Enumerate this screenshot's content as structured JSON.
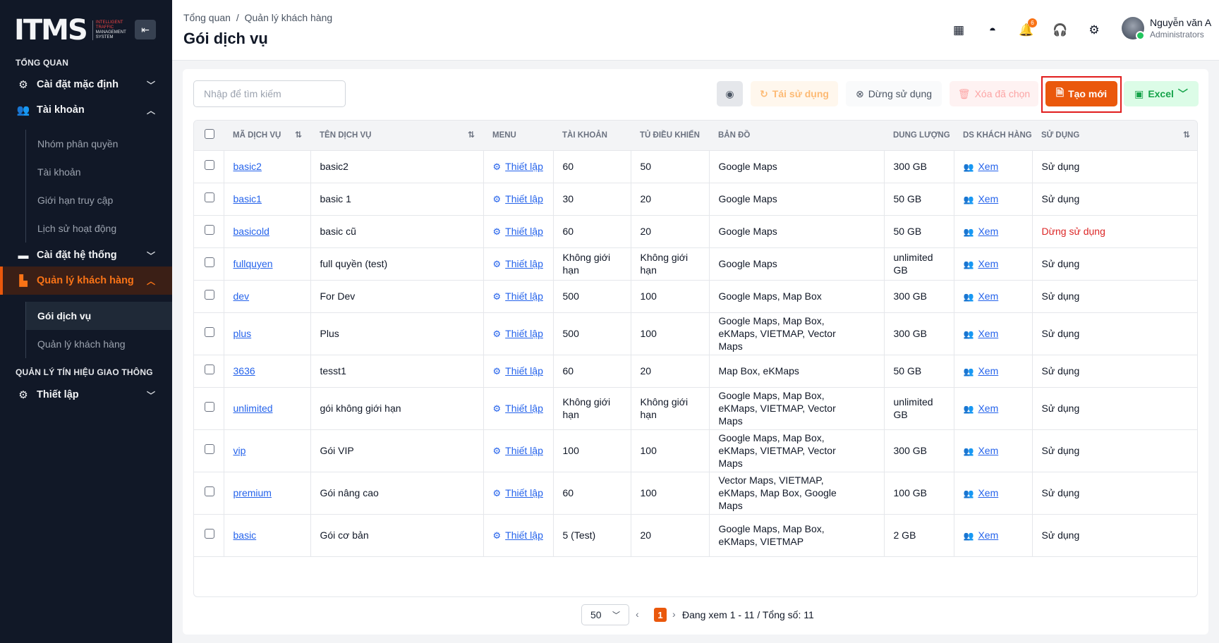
{
  "sidebar": {
    "logo": "ITMS",
    "logo_sub": [
      "INTELLIGENT",
      "TRAFFIC",
      "MANAGEMENT",
      "SYSTEM"
    ],
    "section_overview": "TỔNG QUAN",
    "item_default_settings": "Cài đặt mặc định",
    "item_accounts": "Tài khoản",
    "accounts_sub": [
      "Nhóm phân quyền",
      "Tài khoản",
      "Giới hạn truy cập",
      "Lịch sử hoạt động"
    ],
    "item_system_settings": "Cài đặt hệ thống",
    "item_customers": "Quản lý khách hàng",
    "customers_sub": [
      "Gói dịch vụ",
      "Quản lý khách hàng"
    ],
    "section_traffic": "QUẢN LÝ TÍN HIỆU GIAO THÔNG",
    "item_setup": "Thiết lập"
  },
  "header": {
    "breadcrumb": [
      "Tổng quan",
      "/",
      "Quản lý khách hàng"
    ],
    "title": "Gói dịch vụ",
    "notification_count": "6",
    "user_name": "Nguyễn văn A",
    "user_role": "Administrators"
  },
  "toolbar": {
    "search_placeholder": "Nhập để tìm kiếm",
    "reuse_label": "Tái sử dụng",
    "stop_label": "Dừng sử dụng",
    "delete_label": "Xóa đã chọn",
    "create_label": "Tạo mới",
    "excel_label": "Excel"
  },
  "table": {
    "headers": [
      "MÃ DỊCH VỤ",
      "TÊN DỊCH VỤ",
      "MENU",
      "TÀI KHOẢN",
      "TỦ ĐIỀU KHIỂN",
      "BẢN ĐỒ",
      "DUNG LƯỢNG",
      "DS KHÁCH HÀNG",
      "SỬ DỤNG"
    ],
    "rows": [
      {
        "code": "basic2",
        "name": "basic2",
        "menu": "Thiết lập",
        "accounts": "60",
        "controllers": "50",
        "maps": "Google Maps",
        "storage": "300 GB",
        "customers": "Xem",
        "status": "Sử dụng"
      },
      {
        "code": "basic1",
        "name": "basic 1",
        "menu": "Thiết lập",
        "accounts": "30",
        "controllers": "20",
        "maps": "Google Maps",
        "storage": "50 GB",
        "customers": "Xem",
        "status": "Sử dụng"
      },
      {
        "code": "basicold",
        "name": "basic cũ",
        "menu": "Thiết lập",
        "accounts": "60",
        "controllers": "20",
        "maps": "Google Maps",
        "storage": "50 GB",
        "customers": "Xem",
        "status": "Dừng sử dụng"
      },
      {
        "code": "fullquyen",
        "name": "full quyền (test)",
        "menu": "Thiết lập",
        "accounts": "Không giới hạn",
        "controllers": "Không giới hạn",
        "maps": "Google Maps",
        "storage": "unlimited GB",
        "customers": "Xem",
        "status": "Sử dụng"
      },
      {
        "code": "dev",
        "name": "For Dev",
        "menu": "Thiết lập",
        "accounts": "500",
        "controllers": "100",
        "maps": "Google Maps, Map Box",
        "storage": "300 GB",
        "customers": "Xem",
        "status": "Sử dụng"
      },
      {
        "code": "plus",
        "name": "Plus",
        "menu": "Thiết lập",
        "accounts": "500",
        "controllers": "100",
        "maps": "Google Maps, Map Box, eKMaps, VIETMAP, Vector Maps",
        "storage": "300 GB",
        "customers": "Xem",
        "status": "Sử dụng"
      },
      {
        "code": "3636",
        "name": "tesst1",
        "menu": "Thiết lập",
        "accounts": "60",
        "controllers": "20",
        "maps": "Map Box, eKMaps",
        "storage": "50 GB",
        "customers": "Xem",
        "status": "Sử dụng"
      },
      {
        "code": "unlimited",
        "name": "gói không giới hạn",
        "menu": "Thiết lập",
        "accounts": "Không giới hạn",
        "controllers": "Không giới hạn",
        "maps": "Google Maps, Map Box, eKMaps, VIETMAP, Vector Maps",
        "storage": "unlimited GB",
        "customers": "Xem",
        "status": "Sử dụng"
      },
      {
        "code": "vip",
        "name": "Gói VIP",
        "menu": "Thiết lập",
        "accounts": "100",
        "controllers": "100",
        "maps": "Google Maps, Map Box, eKMaps, VIETMAP, Vector Maps",
        "storage": "300 GB",
        "customers": "Xem",
        "status": "Sử dụng"
      },
      {
        "code": "premium",
        "name": "Gói nâng cao",
        "menu": "Thiết lập",
        "accounts": "60",
        "controllers": "100",
        "maps": "Vector Maps, VIETMAP, eKMaps, Map Box, Google Maps",
        "storage": "100 GB",
        "customers": "Xem",
        "status": "Sử dụng"
      },
      {
        "code": "basic",
        "name": "Gói cơ bản",
        "menu": "Thiết lập",
        "accounts": "5 (Test)",
        "controllers": "20",
        "maps": "Google Maps, Map Box, eKMaps, VIETMAP",
        "storage": "2 GB",
        "customers": "Xem",
        "status": "Sử dụng"
      }
    ]
  },
  "pagination": {
    "page_size": "50",
    "current_page": "1",
    "info": "Đang xem 1 - 11 / Tổng số: 11"
  },
  "colors": {
    "accent": "#ea580c",
    "sidebar_bg": "#111827",
    "link": "#2563eb",
    "stopped": "#dc2626"
  },
  "icons": [
    "collapse-icon",
    "settings-icon",
    "users-icon",
    "chevron-icon",
    "system-icon",
    "building-icon",
    "grid-icon",
    "dashboard-icon",
    "bell-icon",
    "headset-icon",
    "gear-icon",
    "eye-icon",
    "refresh-icon",
    "stop-icon",
    "trash-icon",
    "document-icon",
    "excel-icon",
    "sort-icon",
    "people-icon"
  ]
}
